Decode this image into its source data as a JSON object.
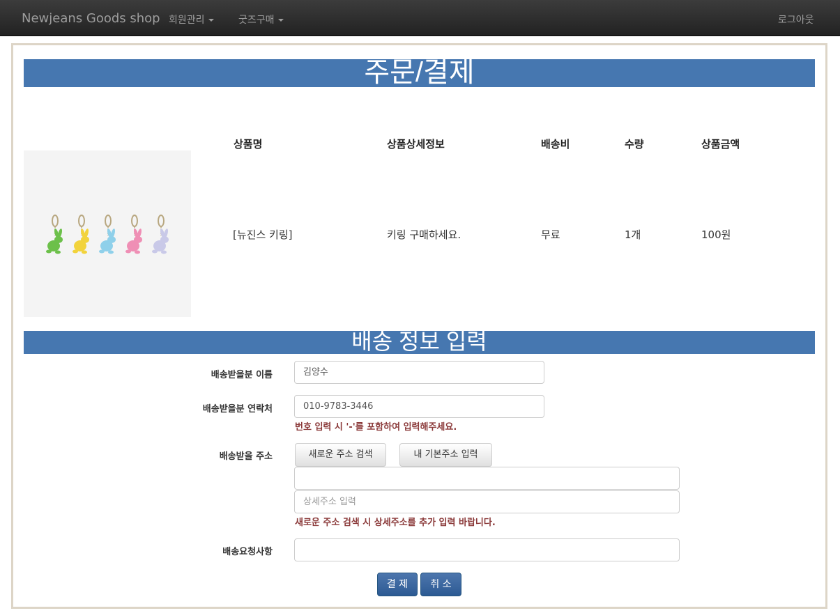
{
  "navbar": {
    "brand": "Newjeans Goods shop",
    "menu_member": "회원관리",
    "menu_goods": "굿즈구매",
    "logout": "로그아웃"
  },
  "page": {
    "title": "주문/결제",
    "shipping_title": "배송 정보 입력"
  },
  "order_table": {
    "headers": [
      "상품명",
      "상품상세정보",
      "배송비",
      "수량",
      "상품금액"
    ],
    "row": [
      "[뉴진스 키링]",
      "키링 구매하세요.",
      "무료",
      "1개",
      "100원"
    ]
  },
  "product_image": {
    "keyring_colors": [
      "#6cc04a",
      "#f2d33c",
      "#8fd0ea",
      "#ef8fb5",
      "#c9c9e8"
    ]
  },
  "shipping_form": {
    "name_label": "배송받을분 이름",
    "name_value": "김양수",
    "phone_label": "배송받을분 연락처",
    "phone_value": "010-9783-3446",
    "phone_help": "번호 입력 시 '-'를 포함하여 입력해주세요.",
    "address_label": "배송받을 주소",
    "search_address_button": "새로운 주소 검색",
    "default_address_button": "내 기본주소 입력",
    "address_value": "",
    "detail_address_placeholder": "상세주소 입력",
    "address_help": "새로운 주소 검색 시 상세주소를 추가 입력 바랍니다.",
    "request_label": "배송요청사항",
    "request_value": ""
  },
  "actions": {
    "pay": "결 제",
    "cancel": "취 소"
  }
}
